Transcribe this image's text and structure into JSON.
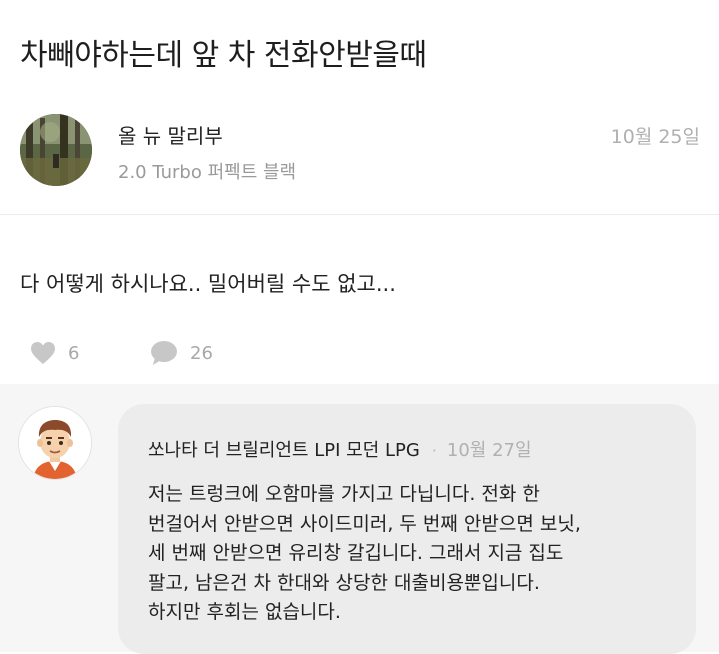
{
  "post": {
    "title": "차빼야하는데 앞 차 전화안받을때",
    "author": {
      "name": "올 뉴 말리부",
      "car": "2.0 Turbo 퍼펙트 블랙",
      "avatar": "forest-photo-avatar"
    },
    "date": "10월 25일",
    "body": "다 어떻게 하시나요.. 밀어버릴 수도 없고...",
    "stats": {
      "likes": "6",
      "comments": "26",
      "like_icon": "heart-icon",
      "comment_icon": "speech-bubble-icon"
    }
  },
  "comment": {
    "author": "쏘나타 더 브릴리언트 LPI 모던 LPG",
    "separator": "·",
    "date": "10월 27일",
    "avatar": "cartoon-man-avatar",
    "lines": [
      "저는 트렁크에 오함마를 가지고 다닙니다. 전화 한",
      "번걸어서 안받으면 사이드미러, 두 번째 안받으면 보닛,",
      "세 번째 안받으면 유리창 갈깁니다. 그래서 지금 집도",
      "팔고, 남은건 차 한대와 상당한 대출비용뿐입니다.",
      "하지만 후회는 없습니다."
    ]
  },
  "colors": {
    "muted_text": "#a8a8a8",
    "icon_gray": "#c7c7c7",
    "bubble_bg": "#ececec",
    "section_bg": "#f6f6f6"
  }
}
